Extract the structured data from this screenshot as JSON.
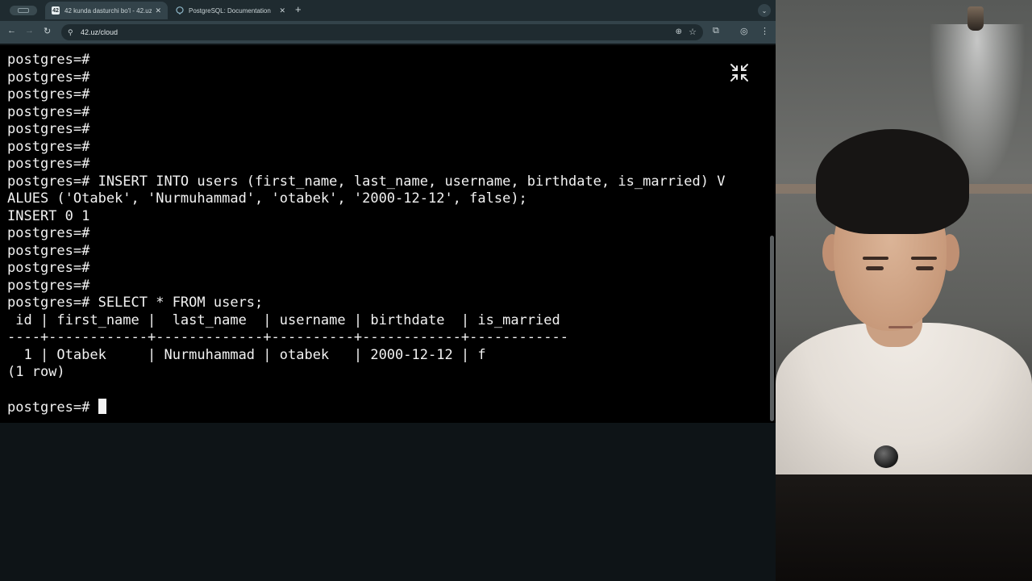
{
  "browser": {
    "tabs": [
      {
        "title": "42 kunda dasturchi bo'l - 42.uz",
        "favicon": "42",
        "active": true
      },
      {
        "title": "PostgreSQL: Documentation",
        "favicon": "elephant-icon",
        "active": false
      }
    ],
    "url": "42.uz/cloud"
  },
  "terminal": {
    "lines": [
      "postgres=#",
      "postgres=#",
      "postgres=#",
      "postgres=#",
      "postgres=#",
      "postgres=#",
      "postgres=#",
      "postgres=# INSERT INTO users (first_name, last_name, username, birthdate, is_married) V",
      "ALUES ('Otabek', 'Nurmuhammad', 'otabek', '2000-12-12', false);",
      "INSERT 0 1",
      "postgres=#",
      "postgres=#",
      "postgres=#",
      "postgres=#",
      "postgres=# SELECT * FROM users;",
      " id | first_name |  last_name  | username | birthdate  | is_married",
      "----+------------+-------------+----------+------------+------------",
      "  1 | Otabek     | Nurmuhammad | otabek   | 2000-12-12 | f",
      "(1 row)",
      ""
    ],
    "prompt": "postgres=# "
  }
}
